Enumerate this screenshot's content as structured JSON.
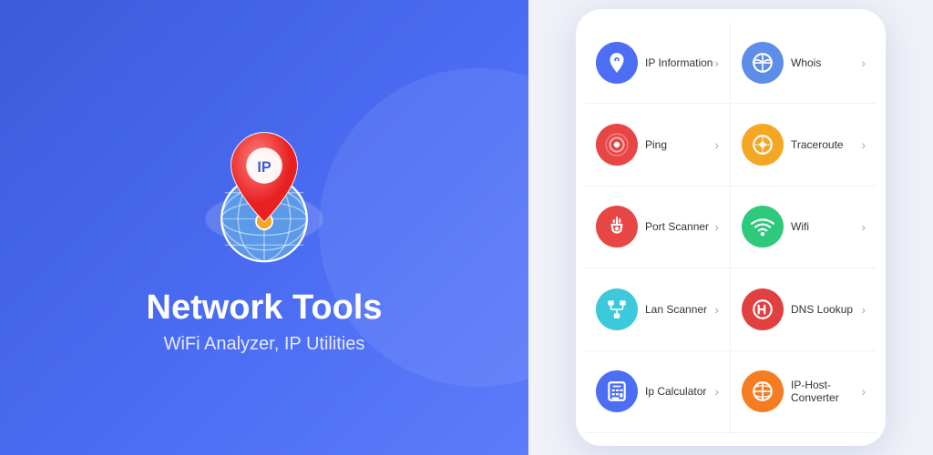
{
  "left": {
    "title": "Network Tools",
    "subtitle": "WiFi Analyzer, IP Utilities"
  },
  "right": {
    "menuItems": [
      {
        "id": "ip-information",
        "label": "IP Information",
        "iconColor": "icon-blue",
        "iconType": "ip-info"
      },
      {
        "id": "whois",
        "label": "Whois",
        "iconColor": "icon-blue2",
        "iconType": "whois"
      },
      {
        "id": "ping",
        "label": "Ping",
        "iconColor": "icon-red",
        "iconType": "ping"
      },
      {
        "id": "traceroute",
        "label": "Traceroute",
        "iconColor": "icon-orange",
        "iconType": "traceroute"
      },
      {
        "id": "port-scanner",
        "label": "Port Scanner",
        "iconColor": "icon-usb",
        "iconType": "usb"
      },
      {
        "id": "wifi",
        "label": "Wifi",
        "iconColor": "icon-green",
        "iconType": "wifi"
      },
      {
        "id": "lan-scanner",
        "label": "Lan Scanner",
        "iconColor": "icon-teal",
        "iconType": "lan"
      },
      {
        "id": "dns-lookup",
        "label": "DNS Lookup",
        "iconColor": "icon-darkred",
        "iconType": "dns"
      },
      {
        "id": "ip-calculator",
        "label": "Ip Calculator",
        "iconColor": "icon-blue",
        "iconType": "calc"
      },
      {
        "id": "ip-host-converter",
        "label": "IP-Host-Converter",
        "iconColor": "icon-orange2",
        "iconType": "convert"
      }
    ]
  }
}
